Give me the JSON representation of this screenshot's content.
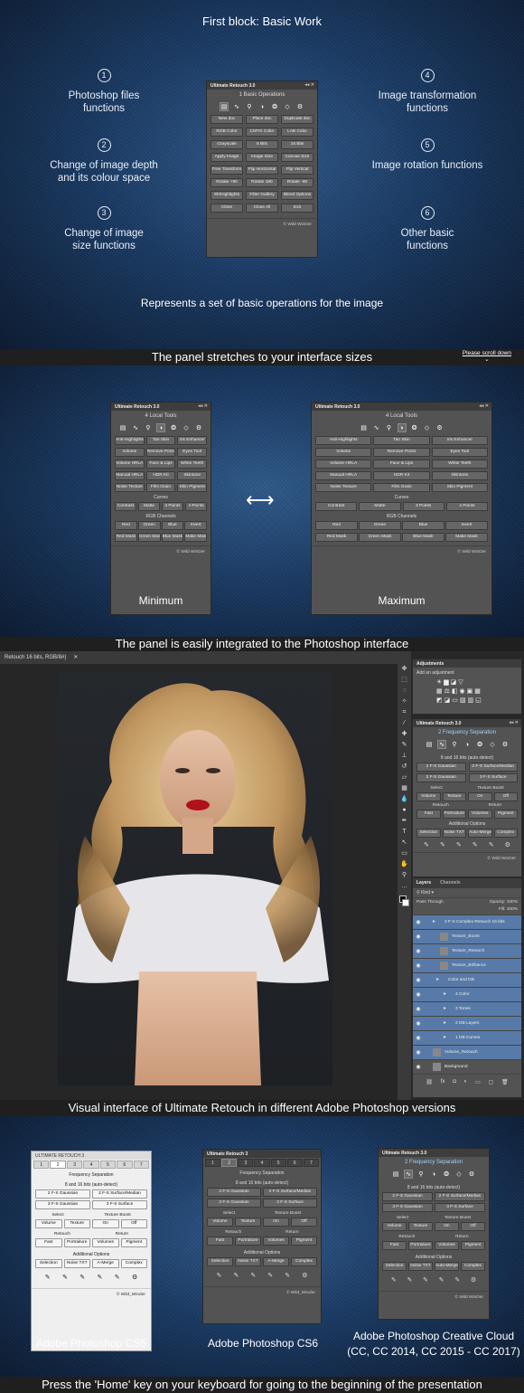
{
  "section1": {
    "title": "First block: Basic Work",
    "features": [
      {
        "num": "1",
        "text": "Photoshop files functions"
      },
      {
        "num": "2",
        "text": "Change of image depth and its colour space"
      },
      {
        "num": "3",
        "text": "Change of image size functions"
      },
      {
        "num": "4",
        "text": "Image transformation functions"
      },
      {
        "num": "5",
        "text": "Image rotation functions"
      },
      {
        "num": "6",
        "text": "Other basic functions"
      }
    ],
    "caption": "Represents a set of basic operations for the image",
    "panel": {
      "title": "Ultimate Retouch 3.0",
      "heading": "1 Basic Operations",
      "buttons": [
        "New doc",
        "Place doc",
        "Duplicate doc",
        "RGB Color",
        "CMYK Color",
        "LAB Color",
        "Grayscale",
        "8 Bits",
        "16 Bits",
        "Apply Image",
        "Image Size",
        "Canvas Size",
        "Free Transform",
        "Flip Horizontal",
        "Flip Vertical",
        "Rotate +90",
        "Rotate 180",
        "Rotate -90",
        "Sh/Highlights",
        "Filter Gallery",
        "Blend Options",
        "Close",
        "Close All",
        "Exit"
      ],
      "footer": "© Wild WinDer"
    }
  },
  "bar1": {
    "text": "The panel stretches to your interface sizes",
    "scroll": "Please scroll down"
  },
  "section2": {
    "panel": {
      "title": "Ultimate Retouch 3.0",
      "heading": "4 Local Tools",
      "buttons": [
        "Anti-Highlights",
        "Tan Skin",
        "Iris Enhancer",
        "Volume",
        "Remove Pores",
        "Eyes Tool",
        "Volume HRLA",
        "Face & Lips",
        "White Teeth",
        "Manual HRLA",
        "HDR Kit",
        "Skintone",
        "Noise Texture",
        "Film Grain",
        "Skin Pigment"
      ],
      "curves_label": "Curves",
      "curves": [
        "Contrast",
        "Matte",
        "3 Points",
        "4 Points"
      ],
      "rgb_label": "RGB Channels",
      "rgb": [
        "Red",
        "Green",
        "Blue",
        "Invert",
        "Red Mask",
        "Green Mask",
        "Blue Mask",
        "Make Mask"
      ],
      "footer": "© Wild WinDer"
    },
    "min_label": "Minimum",
    "max_label": "Maximum"
  },
  "bar2": {
    "text": "The panel is easily integrated to the Photoshop interface"
  },
  "photoshop": {
    "doc_tab": "Retouch 16 bits, RGB/8#)",
    "adjustments": {
      "title": "Adjustments",
      "subtitle": "Add an adjustment"
    },
    "panel": {
      "title": "Ultimate Retouch 3.0",
      "heading": "2 Frequency Separation",
      "depth": "8 and 16 bits (auto-detect)",
      "rows": [
        [
          "2 F-S Gaussian",
          "2 F-S Surface/Median"
        ],
        [
          "3 F-S Gaussian",
          "3 F-S Surface"
        ]
      ],
      "select_label": "Select",
      "boost_label": "Texture Boost",
      "sel_buttons": [
        "Volume",
        "Texture",
        "On",
        "Off"
      ],
      "retouch_label": "Retouch",
      "return_label": "Return",
      "ret_buttons": [
        "Fast",
        "Portraiture",
        "Volumes",
        "Pigment"
      ],
      "addl_label": "Additional Options",
      "addl": [
        "Selection",
        "Noise TXT",
        "Auto-Merge",
        "Complex"
      ],
      "footer": "© Wild WinDer"
    },
    "layers": {
      "tabs": [
        "Layers",
        "Channels"
      ],
      "kind": "Kind",
      "blend": "Pass Through",
      "opacity": "Opacity: 100%",
      "fill": "Fill: 100%",
      "items": [
        "2 F-S Complex Retouch 16 bits",
        "Texture_Boost",
        "Texture_Retouch",
        "Texture_Brilliance",
        "Color and DB",
        "4 Color",
        "3 Tones",
        "2 DB Layers",
        "1 DB Curves",
        "Volume_Retouch",
        "Background"
      ]
    }
  },
  "bar3": {
    "text": "Visual interface of Ultimate Retouch in different Adobe Photoshop versions"
  },
  "section4": {
    "cs5": {
      "title": "ULTIMATE RETOUCH 3",
      "tabs": [
        "1",
        "2",
        "3",
        "4",
        "5",
        "6",
        "7"
      ],
      "footer": "© Wild_Winder"
    },
    "cs6": {
      "title": "Ultimate Retouch 3",
      "tabs": [
        "1",
        "2",
        "3",
        "4",
        "5",
        "6",
        "7"
      ],
      "footer": "© Wild_Winder"
    },
    "cc": {
      "title": "Ultimate Retouch 3.0",
      "footer": "© Wild WinDer"
    },
    "content": {
      "heading": "Frequency Separation",
      "depth": "8 and 16 bits (auto-detect)",
      "row1": [
        "2 F-S Gaussian",
        "2 F-S Surface/Median"
      ],
      "row2": [
        "3 F-S Gaussian",
        "3 F-S Surface"
      ],
      "select": "Select",
      "boost": "Texture Boost",
      "sel": [
        "Volume",
        "Texture",
        "On",
        "Off"
      ],
      "retouch": "Retouch",
      "return": "Return",
      "ret": [
        "Fast",
        "Portraiture",
        "Volumes",
        "Pigment"
      ],
      "addl_label": "Additional Options",
      "addl": [
        "Selection",
        "Noise TXT",
        "A-Merge",
        "Complex"
      ]
    },
    "cc_heading": "2 Frequency Separation",
    "cc_addl": [
      "Selection",
      "Noise TXT",
      "Auto-Merge",
      "Complex"
    ],
    "labels": [
      "Adobe Photoshop CS5",
      "Adobe Photoshop CS6",
      "Adobe Photoshop Creative Cloud",
      "(CC, CC 2014, CC 2015 - CC 2017)"
    ]
  },
  "bar4": {
    "text": "Press the 'Home' key on your keyboard for going to the beginning of the presentation"
  }
}
